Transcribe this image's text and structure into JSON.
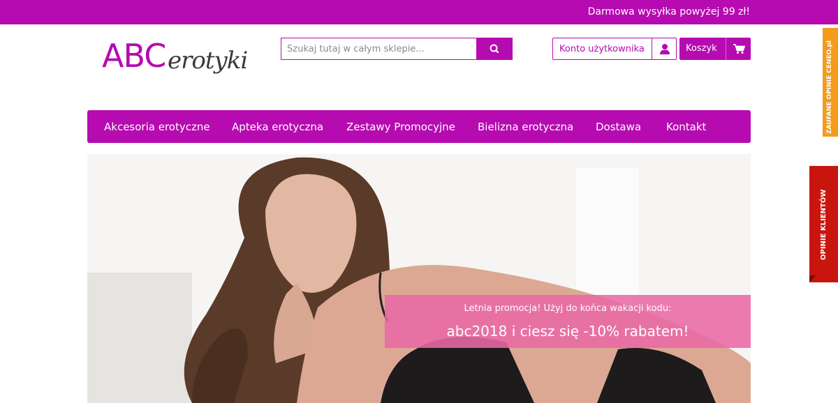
{
  "topbar": {
    "shipping_text": "Darmowa wysyłka powyżej 99 zł!"
  },
  "logo": {
    "part1": "ABC",
    "part2": "erotyki"
  },
  "search": {
    "placeholder": "Szukaj tutaj w całym sklepie..."
  },
  "account": {
    "label": "Konto użytkownika",
    "icon": "user-icon"
  },
  "cart": {
    "label": "Koszyk",
    "icon": "cart-icon"
  },
  "nav": {
    "items": [
      {
        "label": "Akcesoria erotyczne"
      },
      {
        "label": "Apteka erotyczna"
      },
      {
        "label": "Zestawy Promocyjne"
      },
      {
        "label": "Bielizna erotyczna"
      },
      {
        "label": "Dostawa"
      },
      {
        "label": "Kontakt"
      }
    ]
  },
  "hero": {
    "promo_line1": "Letnia promocja! Użyj do końca wakacji kodu:",
    "promo_line2": "abc2018 i ciesz się -10% rabatem!"
  },
  "side_tabs": {
    "zaufane": "ZAUFANE OPINIE CENEO.pl",
    "opinie": "OPINIE KLIENTÓW"
  },
  "colors": {
    "brand": "#b60bb0",
    "promo": "#e969a5",
    "ceneo": "#f29b1d",
    "opinie": "#c8160f"
  }
}
